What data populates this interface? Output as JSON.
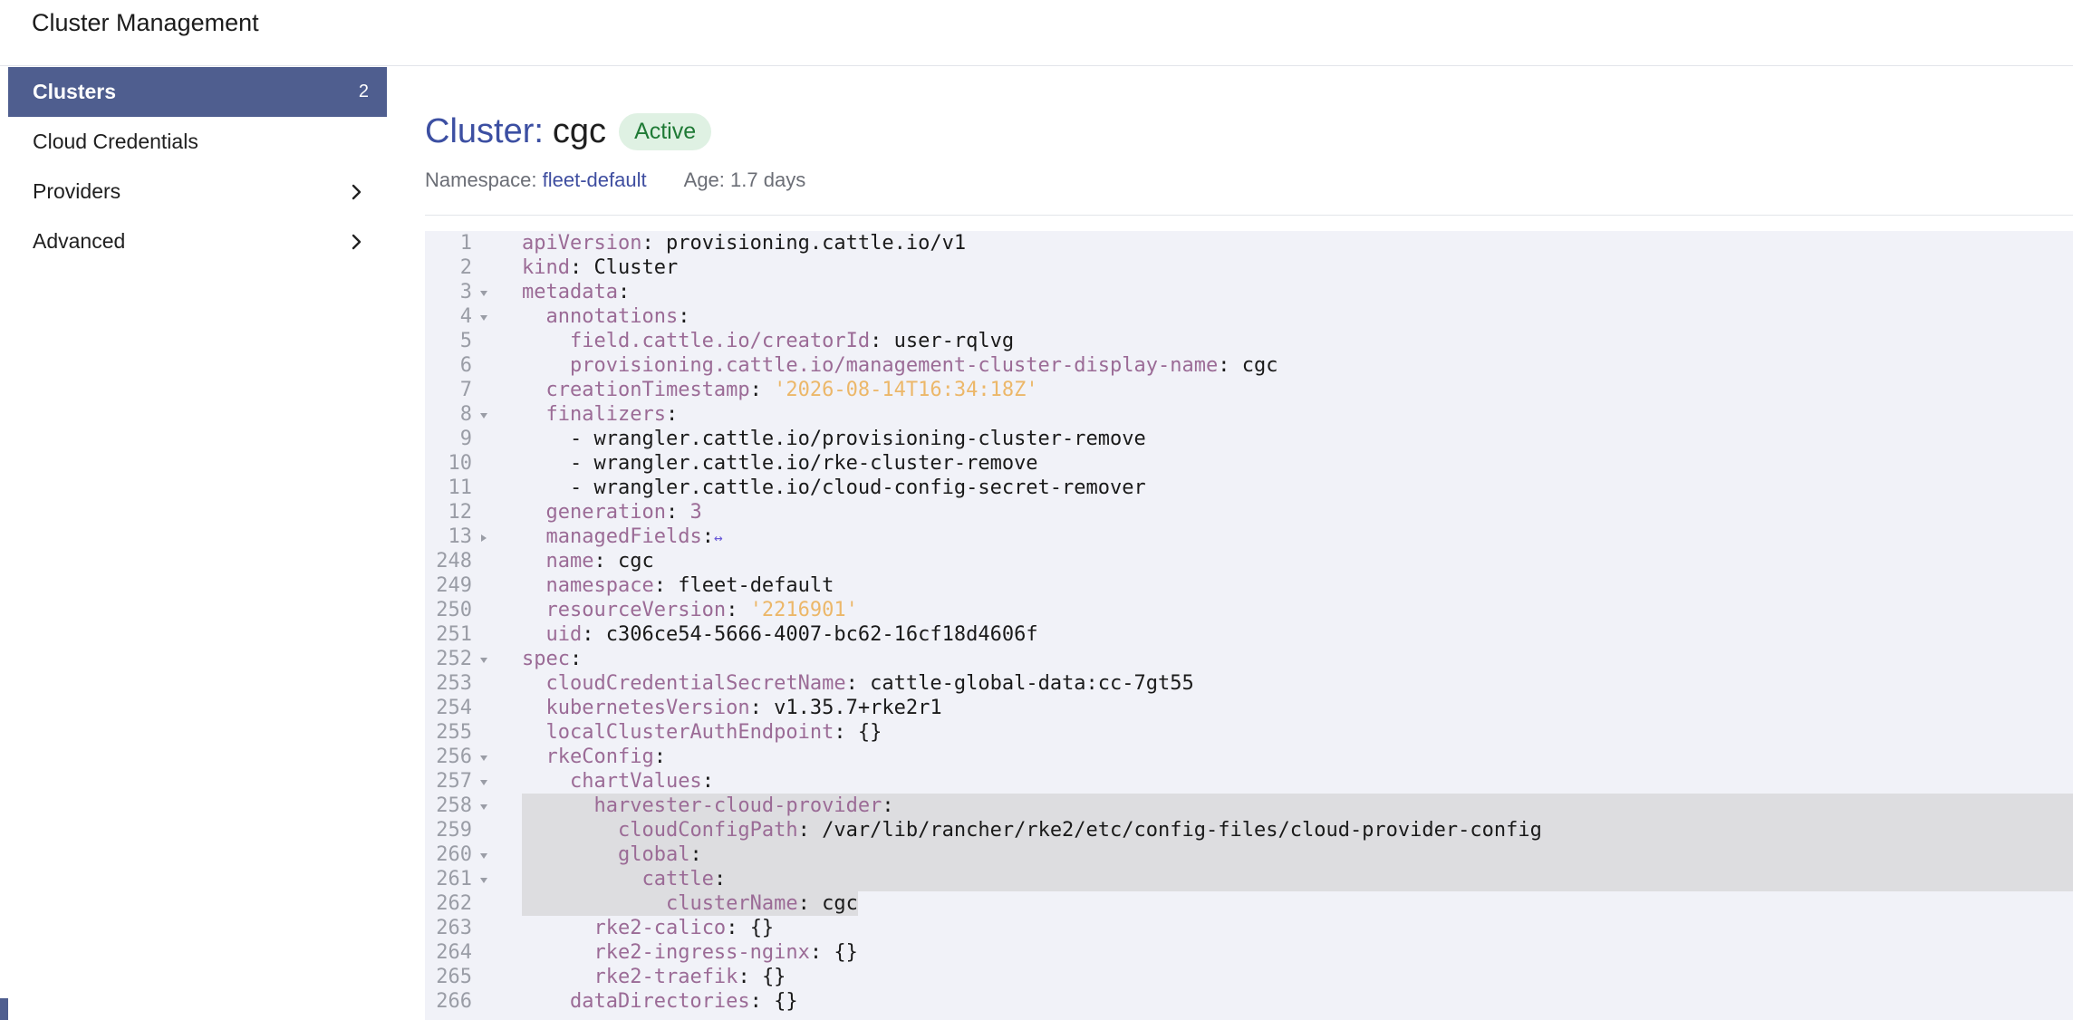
{
  "app": {
    "title": "Cluster Management"
  },
  "sidebar": {
    "items": [
      {
        "label": "Clusters",
        "count": "2",
        "active": true
      },
      {
        "label": "Cloud Credentials"
      },
      {
        "label": "Providers",
        "expandable": true
      },
      {
        "label": "Advanced",
        "expandable": true
      }
    ]
  },
  "page": {
    "title_prefix": "Cluster:",
    "title_name": "cgc",
    "status": "Active",
    "namespace_label": "Namespace:",
    "namespace_value": "fleet-default",
    "age_label": "Age:",
    "age_value": "1.7 days"
  },
  "editor": {
    "lines": [
      {
        "num": "1",
        "fold": "",
        "indent": 0,
        "key": "apiVersion",
        "sep": ": ",
        "value": "provisioning.cattle.io/v1",
        "vtype": "plain"
      },
      {
        "num": "2",
        "fold": "",
        "indent": 0,
        "key": "kind",
        "sep": ": ",
        "value": "Cluster",
        "vtype": "plain"
      },
      {
        "num": "3",
        "fold": "open",
        "indent": 0,
        "key": "metadata",
        "sep": ":",
        "value": "",
        "vtype": "plain"
      },
      {
        "num": "4",
        "fold": "open",
        "indent": 1,
        "key": "annotations",
        "sep": ":",
        "value": "",
        "vtype": "plain"
      },
      {
        "num": "5",
        "fold": "",
        "indent": 2,
        "key": "field.cattle.io/creatorId",
        "sep": ": ",
        "value": "user-rqlvg",
        "vtype": "plain"
      },
      {
        "num": "6",
        "fold": "",
        "indent": 2,
        "key": "provisioning.cattle.io/management-cluster-display-name",
        "sep": ": ",
        "value": "cgc",
        "vtype": "plain"
      },
      {
        "num": "7",
        "fold": "",
        "indent": 1,
        "key": "creationTimestamp",
        "sep": ": ",
        "value": "'2026-08-14T16:34:18Z'",
        "vtype": "string"
      },
      {
        "num": "8",
        "fold": "open",
        "indent": 1,
        "key": "finalizers",
        "sep": ":",
        "value": "",
        "vtype": "plain"
      },
      {
        "num": "9",
        "fold": "",
        "indent": 2,
        "key": "",
        "sep": "- ",
        "value": "wrangler.cattle.io/provisioning-cluster-remove",
        "vtype": "plain"
      },
      {
        "num": "10",
        "fold": "",
        "indent": 2,
        "key": "",
        "sep": "- ",
        "value": "wrangler.cattle.io/rke-cluster-remove",
        "vtype": "plain"
      },
      {
        "num": "11",
        "fold": "",
        "indent": 2,
        "key": "",
        "sep": "- ",
        "value": "wrangler.cattle.io/cloud-config-secret-remover",
        "vtype": "plain"
      },
      {
        "num": "12",
        "fold": "",
        "indent": 1,
        "key": "generation",
        "sep": ": ",
        "value": "3",
        "vtype": "number"
      },
      {
        "num": "13",
        "fold": "closed",
        "indent": 1,
        "key": "managedFields",
        "sep": ":",
        "value": "↔",
        "vtype": "ellipsis"
      },
      {
        "num": "248",
        "fold": "",
        "indent": 1,
        "key": "name",
        "sep": ": ",
        "value": "cgc",
        "vtype": "plain"
      },
      {
        "num": "249",
        "fold": "",
        "indent": 1,
        "key": "namespace",
        "sep": ": ",
        "value": "fleet-default",
        "vtype": "plain"
      },
      {
        "num": "250",
        "fold": "",
        "indent": 1,
        "key": "resourceVersion",
        "sep": ": ",
        "value": "'2216901'",
        "vtype": "string"
      },
      {
        "num": "251",
        "fold": "",
        "indent": 1,
        "key": "uid",
        "sep": ": ",
        "value": "c306ce54-5666-4007-bc62-16cf18d4606f",
        "vtype": "plain"
      },
      {
        "num": "252",
        "fold": "open",
        "indent": 0,
        "key": "spec",
        "sep": ":",
        "value": "",
        "vtype": "plain"
      },
      {
        "num": "253",
        "fold": "",
        "indent": 1,
        "key": "cloudCredentialSecretName",
        "sep": ": ",
        "value": "cattle-global-data:cc-7gt55",
        "vtype": "plain"
      },
      {
        "num": "254",
        "fold": "",
        "indent": 1,
        "key": "kubernetesVersion",
        "sep": ": ",
        "value": "v1.35.7+rke2r1",
        "vtype": "plain"
      },
      {
        "num": "255",
        "fold": "",
        "indent": 1,
        "key": "localClusterAuthEndpoint",
        "sep": ": ",
        "value": "{}",
        "vtype": "plain"
      },
      {
        "num": "256",
        "fold": "open",
        "indent": 1,
        "key": "rkeConfig",
        "sep": ":",
        "value": "",
        "vtype": "plain"
      },
      {
        "num": "257",
        "fold": "open",
        "indent": 2,
        "key": "chartValues",
        "sep": ":",
        "value": "",
        "vtype": "plain"
      },
      {
        "num": "258",
        "fold": "open",
        "indent": 3,
        "key": "harvester-cloud-provider",
        "sep": ":",
        "value": "",
        "vtype": "plain",
        "selection": "full"
      },
      {
        "num": "259",
        "fold": "",
        "indent": 4,
        "key": "cloudConfigPath",
        "sep": ": ",
        "value": "/var/lib/rancher/rke2/etc/config-files/cloud-provider-config",
        "vtype": "plain",
        "selection": "full"
      },
      {
        "num": "260",
        "fold": "open",
        "indent": 4,
        "key": "global",
        "sep": ":",
        "value": "",
        "vtype": "plain",
        "selection": "full"
      },
      {
        "num": "261",
        "fold": "open",
        "indent": 5,
        "key": "cattle",
        "sep": ":",
        "value": "",
        "vtype": "plain",
        "selection": "full"
      },
      {
        "num": "262",
        "fold": "",
        "indent": 6,
        "key": "clusterName",
        "sep": ": ",
        "value": "cgc",
        "vtype": "plain",
        "selection": "partial"
      },
      {
        "num": "263",
        "fold": "",
        "indent": 3,
        "key": "rke2-calico",
        "sep": ": ",
        "value": "{}",
        "vtype": "plain"
      },
      {
        "num": "264",
        "fold": "",
        "indent": 3,
        "key": "rke2-ingress-nginx",
        "sep": ": ",
        "value": "{}",
        "vtype": "plain"
      },
      {
        "num": "265",
        "fold": "",
        "indent": 3,
        "key": "rke2-traefik",
        "sep": ": ",
        "value": "{}",
        "vtype": "plain"
      },
      {
        "num": "266",
        "fold": "",
        "indent": 2,
        "key": "dataDirectories",
        "sep": ": ",
        "value": "{}",
        "vtype": "plain"
      }
    ]
  }
}
